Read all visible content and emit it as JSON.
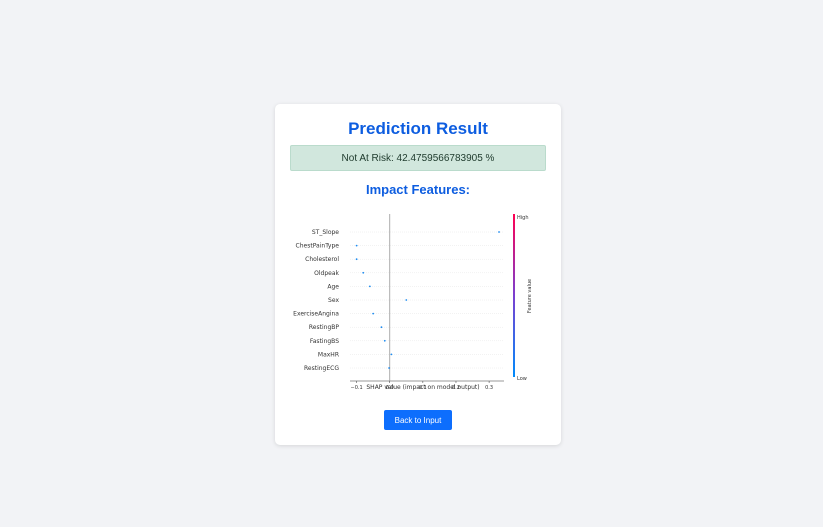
{
  "page": {
    "title": "Prediction Result",
    "result_text": "Not At Risk: 42.4759566783905 %",
    "subtitle": "Impact Features:",
    "back_button_label": "Back to Input"
  },
  "colors": {
    "accent": "#0d5de0",
    "button": "#0d6efd",
    "success_bg": "#d1e7dd",
    "point": "#1f8cf0",
    "colorbar_high": "#ff0051",
    "colorbar_low": "#008bfb"
  },
  "chart_data": {
    "type": "scatter",
    "subtype": "shap-beeswarm",
    "xlabel": "SHAP value (impact on model output)",
    "x_ticks": [
      -0.1,
      0.0,
      0.1,
      0.2,
      0.3
    ],
    "x_tick_labels": [
      "−0.1",
      "0.0",
      "0.1",
      "0.2",
      "0.3"
    ],
    "xlim": [
      -0.12,
      0.345
    ],
    "features": [
      "ST_Slope",
      "ChestPainType",
      "Cholesterol",
      "Oldpeak",
      "Age",
      "Sex",
      "ExerciseAngina",
      "RestingBP",
      "FastingBS",
      "MaxHR",
      "RestingECG"
    ],
    "shap_values": [
      0.33,
      -0.1,
      -0.1,
      -0.08,
      -0.06,
      0.05,
      -0.05,
      -0.025,
      -0.015,
      0.005,
      -0.002
    ],
    "colorbar": {
      "label": "Feature value",
      "high_label": "High",
      "low_label": "Low"
    }
  }
}
